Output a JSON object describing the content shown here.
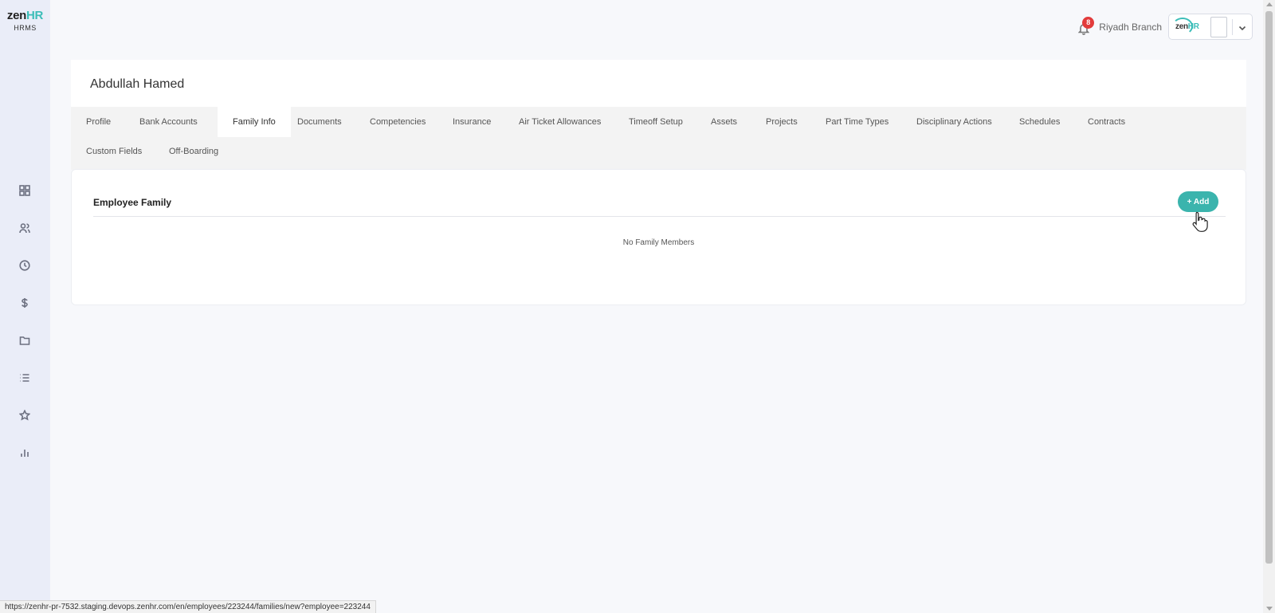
{
  "app": {
    "logo_main": "zen",
    "logo_accent": "HR",
    "logo_sub": "HRMS"
  },
  "sidebar": {
    "items": [
      {
        "icon": "dashboard-icon"
      },
      {
        "icon": "users-icon"
      },
      {
        "icon": "clock-icon"
      },
      {
        "icon": "dollar-icon"
      },
      {
        "icon": "folder-icon"
      },
      {
        "icon": "list-icon"
      },
      {
        "icon": "star-icon"
      },
      {
        "icon": "bar-chart-icon"
      }
    ]
  },
  "header": {
    "notification_count": "8",
    "branch": "Riyadh Branch",
    "account_logo_main": "zen",
    "account_logo_accent": "HR"
  },
  "employee": {
    "name": "Abdullah Hamed"
  },
  "tabs": [
    {
      "label": "Profile"
    },
    {
      "label": "Bank Accounts"
    },
    {
      "label": "Family Info",
      "active": true
    },
    {
      "label": "Documents"
    },
    {
      "label": "Competencies"
    },
    {
      "label": "Insurance"
    },
    {
      "label": "Air Ticket Allowances"
    },
    {
      "label": "Timeoff Setup"
    },
    {
      "label": "Assets"
    },
    {
      "label": "Projects"
    },
    {
      "label": "Part Time Types"
    },
    {
      "label": "Disciplinary Actions"
    },
    {
      "label": "Schedules"
    },
    {
      "label": "Contracts"
    },
    {
      "label": "Custom Fields"
    },
    {
      "label": "Off-Boarding"
    }
  ],
  "family_section": {
    "title": "Employee Family",
    "add_label": "+ Add",
    "empty_message": "No Family Members"
  },
  "status_bar": {
    "url": "https://zenhr-pr-7532.staging.devops.zenhr.com/en/employees/223244/families/new?employee=223244"
  },
  "colors": {
    "accent": "#3bb4ad",
    "badge": "#e23b3b",
    "sidebar_bg": "#eaedf8"
  }
}
